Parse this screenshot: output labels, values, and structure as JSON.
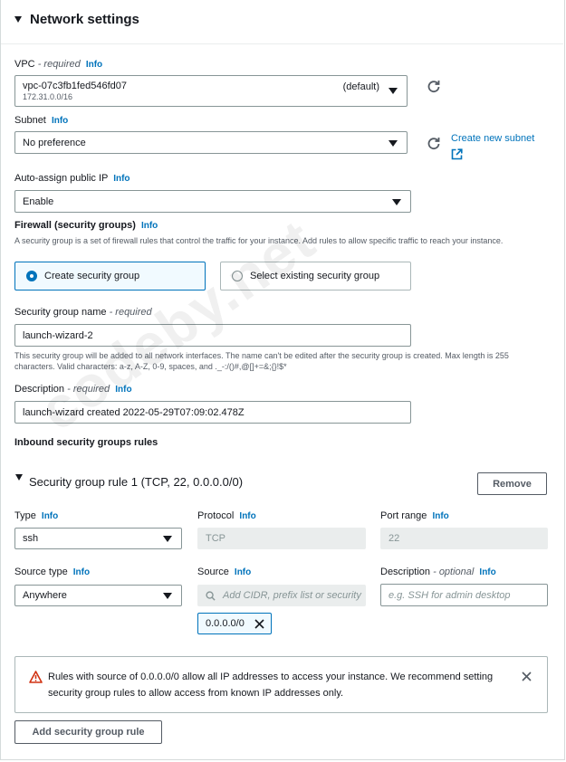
{
  "section": {
    "title": "Network settings"
  },
  "info_label": "Info",
  "vpc": {
    "label": "VPC",
    "required": "- required",
    "value": "vpc-07c3fb1fed546fd07",
    "default_tag": "(default)",
    "cidr": "172.31.0.0/16"
  },
  "subnet": {
    "label": "Subnet",
    "value": "No preference",
    "create_link": "Create new subnet"
  },
  "auto_assign": {
    "label": "Auto-assign public IP",
    "value": "Enable"
  },
  "firewall": {
    "label": "Firewall (security groups)",
    "description": "A security group is a set of firewall rules that control the traffic for your instance. Add rules to allow specific traffic to reach your instance.",
    "options": [
      "Create security group",
      "Select existing security group"
    ],
    "selected": "Create security group"
  },
  "sg_name": {
    "label": "Security group name",
    "required": "- required",
    "value": "launch-wizard-2",
    "help": "This security group will be added to all network interfaces. The name can't be edited after the security group is created. Max length is 255 characters. Valid characters: a-z, A-Z, 0-9, spaces, and ._-:/()#,@[]+=&;{}!$*"
  },
  "description": {
    "label": "Description",
    "required": "- required",
    "value": "launch-wizard created 2022-05-29T07:09:02.478Z"
  },
  "inbound": {
    "title": "Inbound security groups rules"
  },
  "rule": {
    "title": "Security group rule 1 (TCP, 22, 0.0.0.0/0)",
    "remove": "Remove",
    "type_label": "Type",
    "type_value": "ssh",
    "protocol_label": "Protocol",
    "protocol_value": "TCP",
    "port_label": "Port range",
    "port_value": "22",
    "source_type_label": "Source type",
    "source_type_value": "Anywhere",
    "source_label": "Source",
    "source_placeholder": "Add CIDR, prefix list or security",
    "source_token": "0.0.0.0/0",
    "desc_label": "Description",
    "desc_optional": "- optional",
    "desc_placeholder": "e.g. SSH for admin desktop"
  },
  "alert": {
    "text": "Rules with source of 0.0.0.0/0 allow all IP addresses to access your instance. We recommend setting security group rules to allow access from known IP addresses only."
  },
  "add_rule_button": "Add security group rule",
  "watermark": "codeby.net",
  "colors": {
    "link": "#0073bb",
    "warning": "#d13212",
    "border": "#879596"
  }
}
